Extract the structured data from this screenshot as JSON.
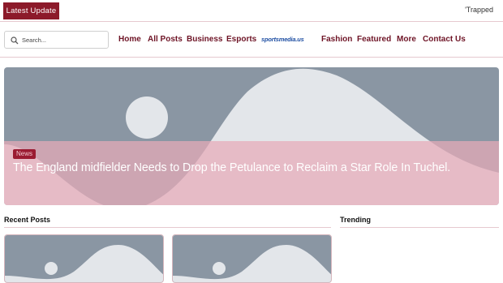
{
  "topbar": {
    "latest_label": "Latest Update",
    "ticker_text": "'Trapped"
  },
  "search": {
    "placeholder": "Search..."
  },
  "nav": {
    "home": "Home",
    "all_posts": "All Posts",
    "business": "Business",
    "esports": "Esports",
    "logo_text": "sportsmedia.us",
    "fashion": "Fashion",
    "featured": "Featured",
    "more": "More",
    "contact": "Contact Us"
  },
  "hero": {
    "category": "News",
    "title": "The England midfielder Needs to Drop the Petulance to Reclaim a Star Role In Tuchel."
  },
  "sections": {
    "recent_posts": "Recent Posts",
    "trending": "Trending"
  },
  "colors": {
    "brand": "#8c1a2a",
    "nav_text": "#6e1426",
    "placeholder_bg": "#8a96a3",
    "placeholder_shape": "#e3e6ea",
    "overlay": "#e8aab8"
  },
  "icons": {
    "search": "search-icon",
    "image_placeholder": "image-placeholder-icon"
  }
}
